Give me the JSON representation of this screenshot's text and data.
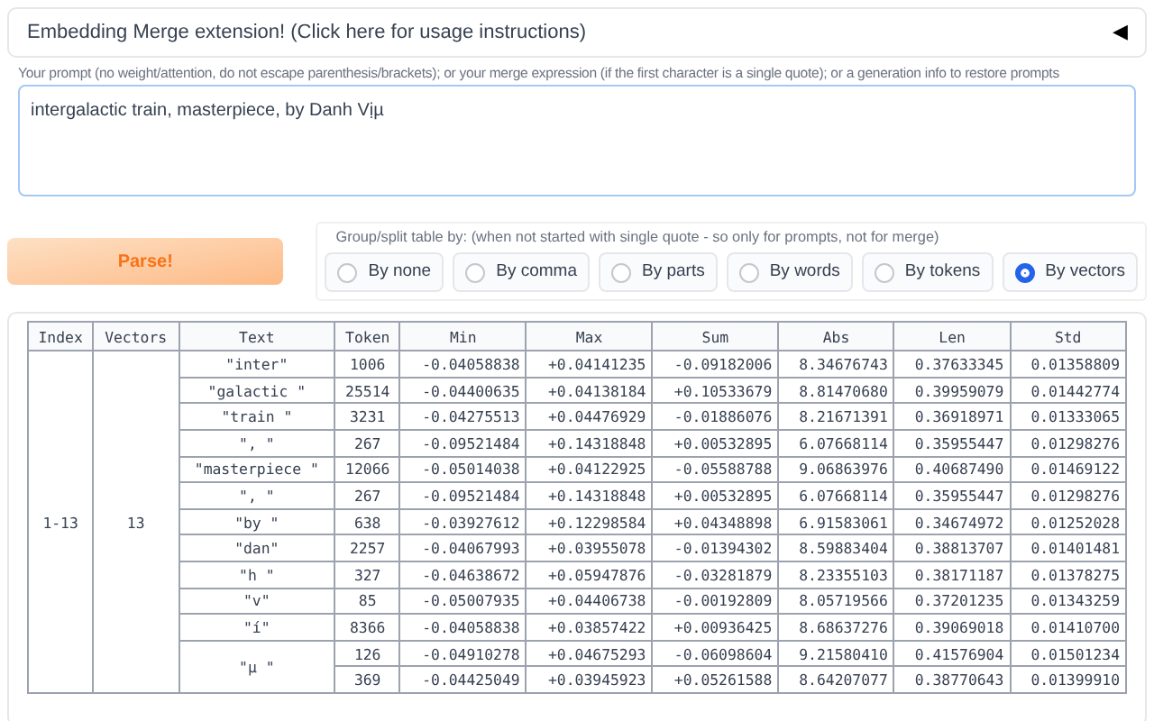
{
  "accordion": {
    "title": "Embedding Merge extension! (Click here for usage instructions)",
    "toggle": "◀",
    "expanded": false
  },
  "prompt": {
    "label": "Your prompt (no weight/attention, do not escape parenthesis/brackets); or your merge expression (if the first character is a single quote); or a generation info to restore prompts",
    "value": "intergalactic train, masterpiece, by Danh Vịµ"
  },
  "parse_button": "Parse!",
  "group_by": {
    "label": "Group/split table by: (when not started with single quote - so only for prompts, not for merge)",
    "options": [
      {
        "label": "By none",
        "selected": false
      },
      {
        "label": "By comma",
        "selected": false
      },
      {
        "label": "By parts",
        "selected": false
      },
      {
        "label": "By words",
        "selected": false
      },
      {
        "label": "By tokens",
        "selected": false
      },
      {
        "label": "By vectors",
        "selected": true
      }
    ]
  },
  "table": {
    "columns": [
      "Index",
      "Vectors",
      "Text",
      "Token",
      "Min",
      "Max",
      "Sum",
      "Abs",
      "Len",
      "Std"
    ],
    "groups": [
      {
        "index": "1-13",
        "vectors": "13",
        "texts": [
          {
            "text": "\"inter\"",
            "rows": [
              [
                "1006",
                "-0.04058838",
                "+0.04141235",
                "-0.09182006",
                "8.34676743",
                "0.37633345",
                "0.01358809"
              ]
            ]
          },
          {
            "text": "\"galactic \"",
            "rows": [
              [
                "25514",
                "-0.04400635",
                "+0.04138184",
                "+0.10533679",
                "8.81470680",
                "0.39959079",
                "0.01442774"
              ]
            ]
          },
          {
            "text": "\"train \"",
            "rows": [
              [
                "3231",
                "-0.04275513",
                "+0.04476929",
                "-0.01886076",
                "8.21671391",
                "0.36918971",
                "0.01333065"
              ]
            ]
          },
          {
            "text": "\", \"",
            "rows": [
              [
                "267",
                "-0.09521484",
                "+0.14318848",
                "+0.00532895",
                "6.07668114",
                "0.35955447",
                "0.01298276"
              ]
            ]
          },
          {
            "text": "\"masterpiece \"",
            "rows": [
              [
                "12066",
                "-0.05014038",
                "+0.04122925",
                "-0.05588788",
                "9.06863976",
                "0.40687490",
                "0.01469122"
              ]
            ]
          },
          {
            "text": "\", \"",
            "rows": [
              [
                "267",
                "-0.09521484",
                "+0.14318848",
                "+0.00532895",
                "6.07668114",
                "0.35955447",
                "0.01298276"
              ]
            ]
          },
          {
            "text": "\"by \"",
            "rows": [
              [
                "638",
                "-0.03927612",
                "+0.12298584",
                "+0.04348898",
                "6.91583061",
                "0.34674972",
                "0.01252028"
              ]
            ]
          },
          {
            "text": "\"dan\"",
            "rows": [
              [
                "2257",
                "-0.04067993",
                "+0.03955078",
                "-0.01394302",
                "8.59883404",
                "0.38813707",
                "0.01401481"
              ]
            ]
          },
          {
            "text": "\"h \"",
            "rows": [
              [
                "327",
                "-0.04638672",
                "+0.05947876",
                "-0.03281879",
                "8.23355103",
                "0.38171187",
                "0.01378275"
              ]
            ]
          },
          {
            "text": "\"v\"",
            "rows": [
              [
                "85",
                "-0.05007935",
                "+0.04406738",
                "-0.00192809",
                "8.05719566",
                "0.37201235",
                "0.01343259"
              ]
            ]
          },
          {
            "text": "\"í\"",
            "rows": [
              [
                "8366",
                "-0.04058838",
                "+0.03857422",
                "+0.00936425",
                "8.68637276",
                "0.39069018",
                "0.01410700"
              ]
            ]
          },
          {
            "text": "\"µ \"",
            "rows": [
              [
                "126",
                "-0.04910278",
                "+0.04675293",
                "-0.06098604",
                "9.21580410",
                "0.41576904",
                "0.01501234"
              ],
              [
                "369",
                "-0.04425049",
                "+0.03945923",
                "+0.05261588",
                "8.64207077",
                "0.38770643",
                "0.01399910"
              ]
            ]
          }
        ]
      }
    ]
  }
}
